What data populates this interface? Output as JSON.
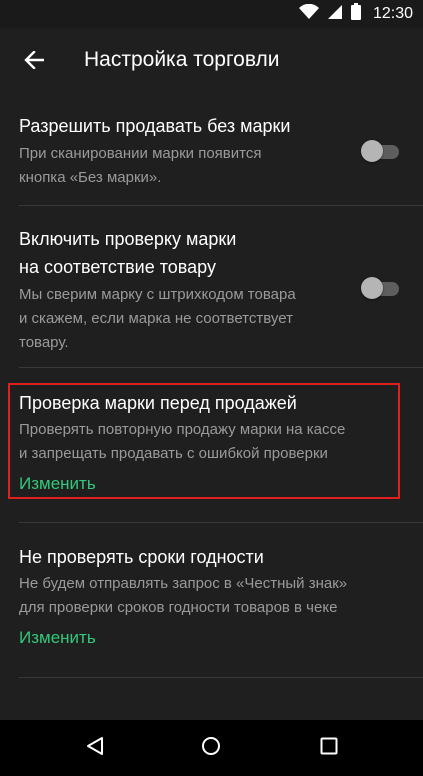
{
  "status_bar": {
    "time": "12:30",
    "icons": [
      "wifi-icon",
      "signal-icon",
      "battery-icon"
    ]
  },
  "toolbar": {
    "back_icon": "arrow-left-icon",
    "title": "Настройка торговли"
  },
  "settings": [
    {
      "title": "Разрешить продавать без марки",
      "description_lines": [
        "При сканировании марки появится",
        "кнопка «Без марки»."
      ],
      "toggle_on": false
    },
    {
      "title_lines": [
        "Включить проверку марки",
        "на соответствие товару"
      ],
      "description_lines": [
        "Мы сверим марку с штрихкодом товара",
        "и скажем, если марка не соответствует",
        "товару."
      ],
      "toggle_on": false
    },
    {
      "title": "Проверка марки перед продажей",
      "description_lines": [
        "Проверять повторную продажу марки на кассе",
        "и запрещать продавать с ошибкой проверки"
      ],
      "link": "Изменить",
      "highlighted": true
    },
    {
      "title": "Не проверять сроки годности",
      "description_lines": [
        "Не будем отправлять запрос в «Честный знак»",
        "для проверки сроков годности товаров в чеке"
      ],
      "link": "Изменить"
    }
  ],
  "colors": {
    "background": "#201f1f",
    "accent_link": "#32c87a",
    "highlight_border": "#e0201f",
    "secondary_text": "#9a9a9a"
  },
  "nav_bar": {
    "icons": [
      "back-triangle-icon",
      "home-circle-icon",
      "recents-square-icon"
    ]
  }
}
